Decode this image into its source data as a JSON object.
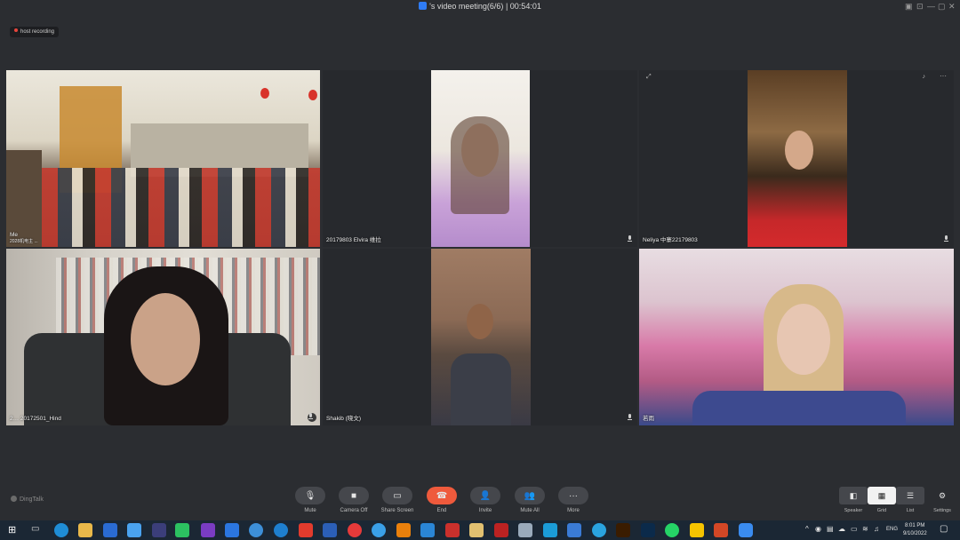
{
  "window": {
    "title": "'s video meeting(6/6)",
    "separator": "|",
    "timer": "00:54:01"
  },
  "recording": {
    "label": "host recording"
  },
  "tiles": [
    {
      "name": "Me",
      "subtitle": "2028机电主 ...",
      "mic": false
    },
    {
      "name": "20179803 Elvira 维拉",
      "mic": true
    },
    {
      "name": "Neliya 中寨22179803",
      "mic": true
    },
    {
      "name": "2… 20172501_Hind",
      "mic": true
    },
    {
      "name": "Shakib (晓文)",
      "mic": false
    },
    {
      "name": "若雨",
      "mic": false
    }
  ],
  "toolbar": {
    "brand": "DingTalk",
    "buttons": [
      {
        "label": "Mute",
        "icon": "microphone-icon"
      },
      {
        "label": "Camera Off",
        "icon": "camera-icon"
      },
      {
        "label": "Share Screen",
        "icon": "screen-share-icon"
      },
      {
        "label": "End",
        "icon": "phone-end-icon"
      },
      {
        "label": "Invite",
        "icon": "add-user-icon"
      },
      {
        "label": "Mute All",
        "icon": "mute-all-icon"
      },
      {
        "label": "More",
        "icon": "more-icon"
      }
    ],
    "views": [
      {
        "label": "Speaker",
        "icon": "speaker-layout-icon"
      },
      {
        "label": "Grid",
        "icon": "grid-layout-icon"
      },
      {
        "label": "List",
        "icon": "list-layout-icon"
      }
    ],
    "settings_label": "Settings"
  },
  "taskbar": {
    "lang": "ENG",
    "time": "8:01 PM",
    "date": "9/10/2022"
  },
  "colors": {
    "end": "#ef5a3c",
    "accent": "#2f7cf6",
    "background": "#2b2d31"
  }
}
